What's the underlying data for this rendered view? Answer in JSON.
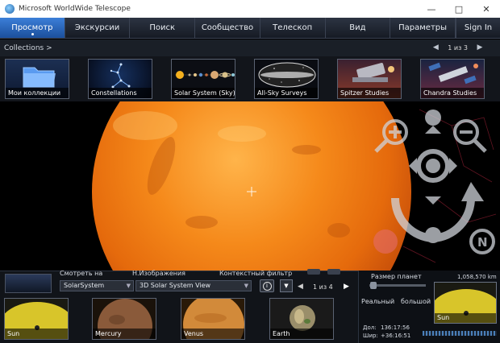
{
  "window": {
    "title": "Microsoft WorldWide Telescope"
  },
  "menu": {
    "items": [
      {
        "label": "Просмотр",
        "active": true
      },
      {
        "label": "Экскурсии"
      },
      {
        "label": "Поиск"
      },
      {
        "label": "Сообщество"
      },
      {
        "label": "Телескоп"
      },
      {
        "label": "Вид"
      },
      {
        "label": "Параметры"
      }
    ],
    "signin": "Sign In"
  },
  "nav": {
    "breadcrumb": "Collections  >",
    "pager": "1 из 3"
  },
  "collections": [
    {
      "label": "Мои коллекции",
      "icon": "folder-icon"
    },
    {
      "label": "Constellations",
      "icon": "constellation-icon"
    },
    {
      "label": "Solar System (Sky)",
      "icon": "planets-icon"
    },
    {
      "label": "All-Sky Surveys",
      "icon": "sky-survey-icon"
    },
    {
      "label": "Spitzer Studies",
      "icon": "telescope-icon"
    },
    {
      "label": "Chandra Studies",
      "icon": "satellite-icon"
    }
  ],
  "bottom": {
    "look_at_label": "Смотреть на",
    "look_at_value": "SolarSystem",
    "imagery_label": "Н.Изображения",
    "imagery_value": "3D Solar System View",
    "filter_label": "Контекстный фильтр",
    "pager": "1 из 4",
    "planets": [
      {
        "label": "Sun"
      },
      {
        "label": "Mercury"
      },
      {
        "label": "Venus"
      },
      {
        "label": "Earth"
      }
    ]
  },
  "right": {
    "planet_size_label": "Размер планет",
    "real_label": "Реальный",
    "large_label": "большой",
    "distance": "1,058,570 km",
    "sun_label": "Sun",
    "coord_dec_label": "Дол:",
    "coord_dec_value": "136:17:56",
    "coord_lat_label": "Шир:",
    "coord_lat_value": "+36:16:51"
  },
  "colors": {
    "accent": "#2d6fcb",
    "sun": "#f07a12"
  }
}
